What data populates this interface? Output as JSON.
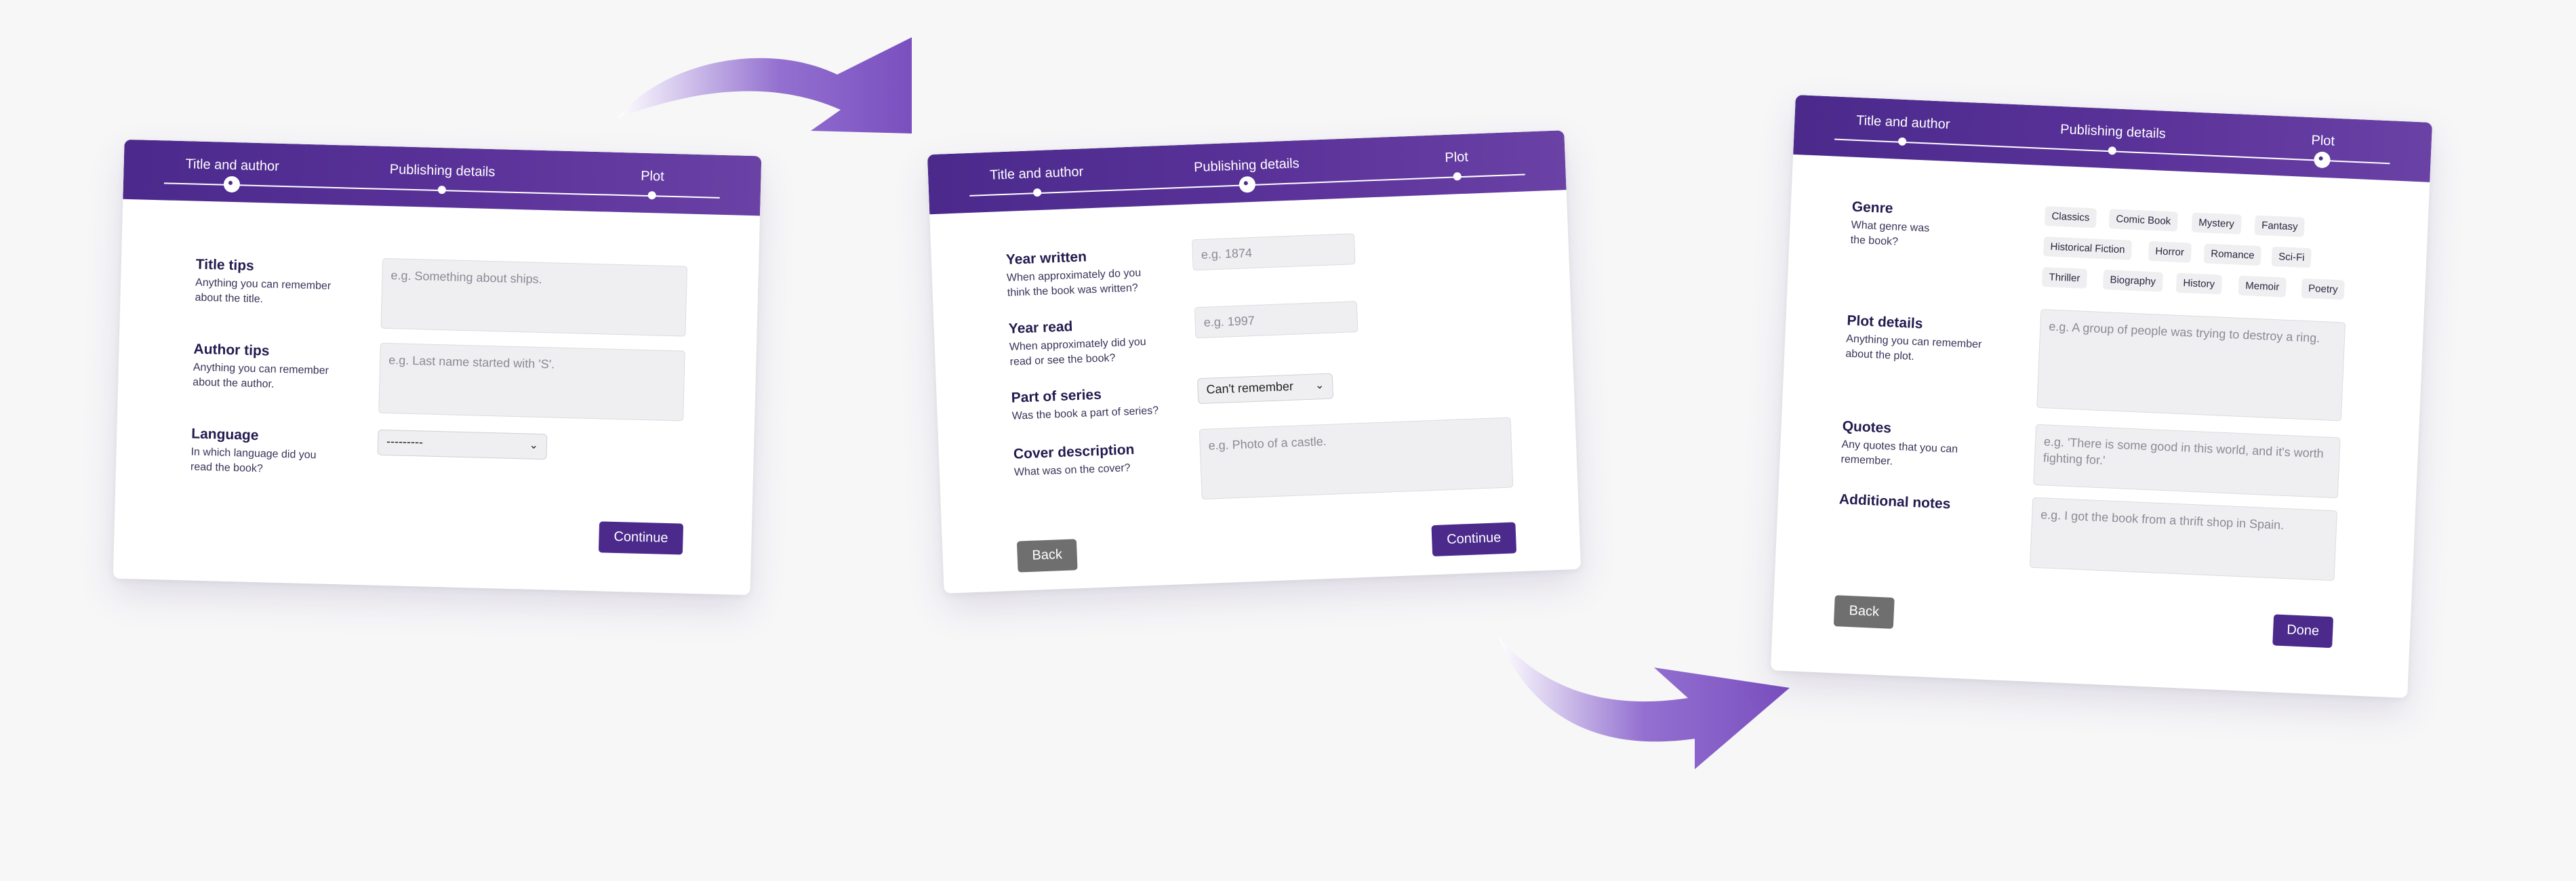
{
  "steps": [
    "Title and author",
    "Publishing details",
    "Plot"
  ],
  "card1": {
    "title_tips": {
      "label": "Title tips",
      "help1": "Anything you can remember",
      "help2": "about the title.",
      "placeholder": "e.g. Something about ships."
    },
    "author_tips": {
      "label": "Author tips",
      "help1": "Anything you can remember",
      "help2": "about the author.",
      "placeholder": "e.g. Last name started with 'S'."
    },
    "language": {
      "label": "Language",
      "help1": "In which language did you",
      "help2": "read the book?",
      "value": "---------"
    },
    "continue": "Continue"
  },
  "card2": {
    "year_written": {
      "label": "Year written",
      "help1": "When approximately do you",
      "help2": "think the book was written?",
      "placeholder": "e.g. 1874"
    },
    "year_read": {
      "label": "Year read",
      "help1": "When approximately did you",
      "help2": "read or see the book?",
      "placeholder": "e.g. 1997"
    },
    "part_of_series": {
      "label": "Part of series",
      "help": "Was the book a part of series?",
      "value": "Can't remember"
    },
    "cover_description": {
      "label": "Cover description",
      "help": "What was on the cover?",
      "placeholder": "e.g. Photo of a castle."
    },
    "back": "Back",
    "continue": "Continue"
  },
  "card3": {
    "genre": {
      "label": "Genre",
      "help1": "What genre was",
      "help2": "the book?",
      "options": [
        "Classics",
        "Comic Book",
        "Mystery",
        "Fantasy",
        "Historical Fiction",
        "Horror",
        "Romance",
        "Sci-Fi",
        "Thriller",
        "Biography",
        "History",
        "Memoir",
        "Poetry"
      ]
    },
    "plot_details": {
      "label": "Plot details",
      "help1": "Anything you can remember",
      "help2": "about the plot.",
      "placeholder": "e.g. A group of people was trying to destroy a ring."
    },
    "quotes": {
      "label": "Quotes",
      "help1": "Any quotes that you can",
      "help2": "remember.",
      "placeholder": "e.g. 'There is some good in this world, and it's worth fighting for.'"
    },
    "additional_notes": {
      "label": "Additional notes",
      "placeholder": "e.g. I got the book from a thrift shop in Spain."
    },
    "back": "Back",
    "done": "Done"
  },
  "colors": {
    "accent": "#4b2a8c",
    "arrow": "#7f55c4",
    "back_button": "#6f6f70"
  },
  "icons": [
    "chevron-down-icon",
    "flow-arrow-icon"
  ]
}
